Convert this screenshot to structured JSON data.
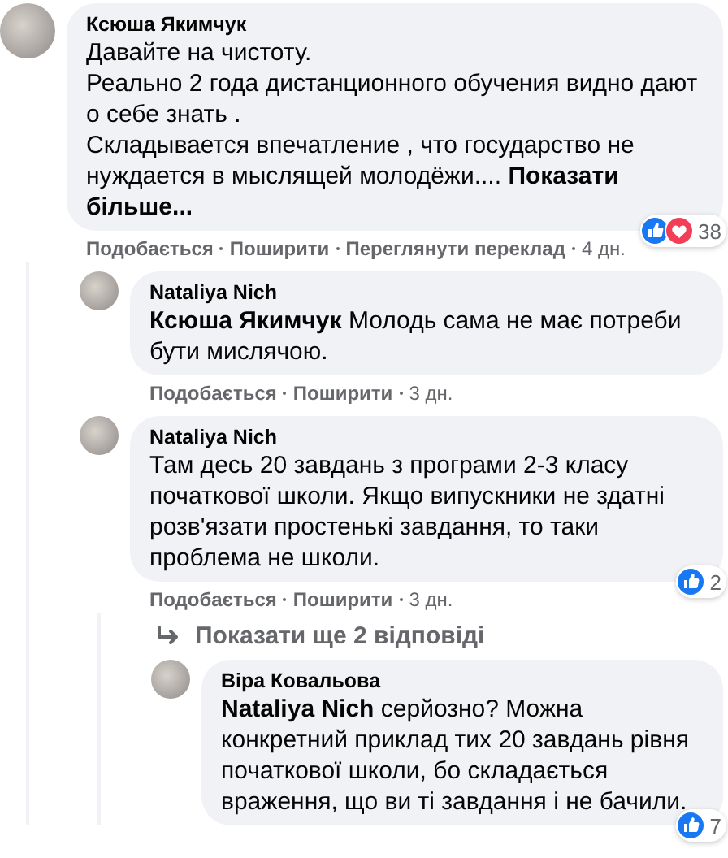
{
  "comments": [
    {
      "author": "Ксюша Якимчук",
      "text": "Давайте на чистоту.\nРеально 2 года дистанционного обучения видно дают о себе знать .\nСкладывается впечатление , что государство не нуждается в мыслящей молодёжи.... **Показати більше...**",
      "actions": [
        "Подобається",
        "Поширити",
        "Переглянути переклад"
      ],
      "time": "4 дн.",
      "reactions": {
        "icons": [
          {
            "kind": "like"
          },
          {
            "kind": "love"
          }
        ],
        "count": "38"
      },
      "children": [
        {
          "author": "Nataliya Nich",
          "text": "**Ксюша Якимчук** Молодь сама не має потреби бути мислячою.",
          "actions": [
            "Подобається",
            "Поширити"
          ],
          "time": "3 дн."
        },
        {
          "author": "Nataliya Nich",
          "text": "Там десь 20 завдань з програми 2-3 класу початкової школи. Якщо випускники не здатні розв'язати простенькі завдання, то таки проблема не школи.",
          "actions": [
            "Подобається",
            "Поширити"
          ],
          "time": "3 дн.",
          "reactions": {
            "icons": [
              {
                "kind": "like"
              }
            ],
            "count": "2"
          },
          "more_replies": "Показати ще 2 відповіді",
          "children": [
            {
              "author": "Віра Ковальова",
              "text": "**Nataliya Nich** серйозно? Можна конкретний приклад тих 20 завдань рівня початкової школи, бо складається враження, що ви ті завдання і не бачили.",
              "reactions": {
                "icons": [
                  {
                    "kind": "like"
                  }
                ],
                "count": "7"
              }
            }
          ]
        }
      ]
    }
  ]
}
